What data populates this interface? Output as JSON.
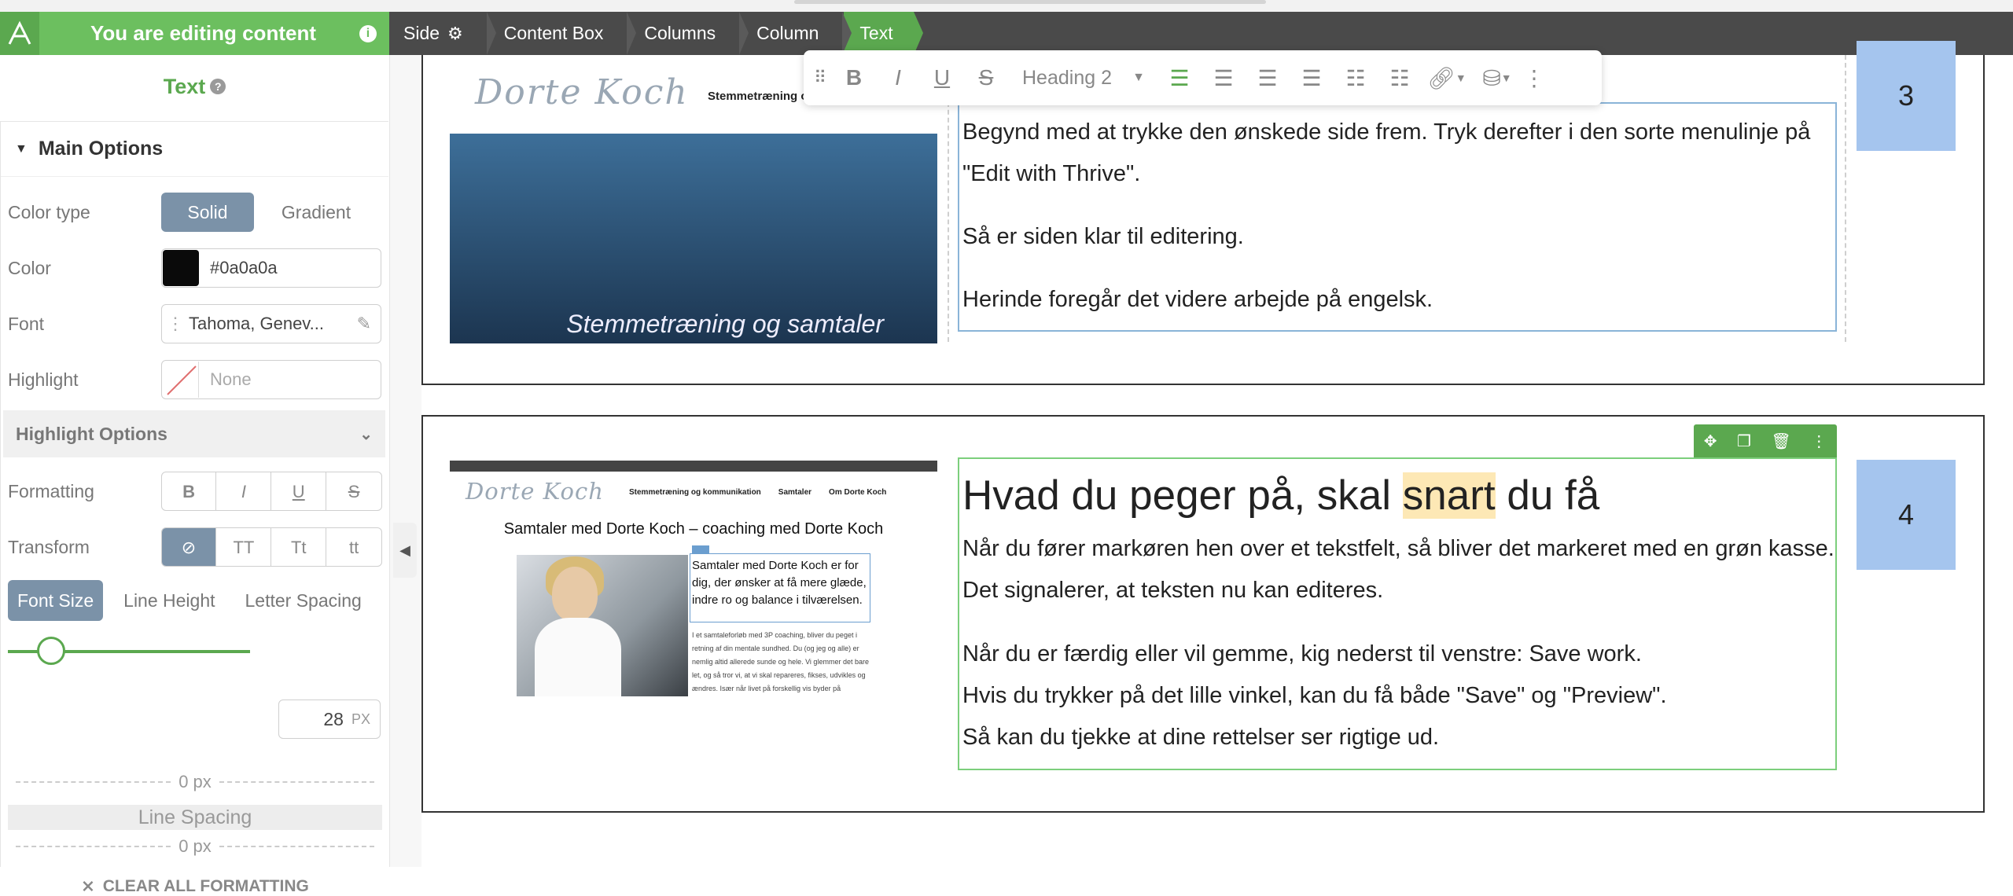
{
  "topbar": {
    "editing_label": "You are editing content",
    "crumbs": [
      "Side",
      "Content Box",
      "Columns",
      "Column",
      "Text"
    ],
    "colors": {
      "bar": "#4a4a4a",
      "green": "#6cbf5f",
      "active": "#5ba84f"
    }
  },
  "sidebar": {
    "title": "Text",
    "main_options": "Main Options",
    "color_type_label": "Color type",
    "color_type_options": [
      "Solid",
      "Gradient"
    ],
    "color_label": "Color",
    "color_value": "#0a0a0a",
    "color_display": "#0a0a0a",
    "font_label": "Font",
    "font_value": "Tahoma, Genev...",
    "highlight_label": "Highlight",
    "highlight_value": "None",
    "highlight_options": "Highlight Options",
    "formatting_label": "Formatting",
    "formatting_buttons": [
      "B",
      "I",
      "U",
      "S"
    ],
    "transform_label": "Transform",
    "transform_buttons": [
      "⊘",
      "TT",
      "Tt",
      "tt"
    ],
    "size_tabs": [
      "Font Size",
      "Line Height",
      "Letter Spacing"
    ],
    "font_size_value": "28",
    "font_size_unit": "PX",
    "font_size_fraction": 0.18,
    "spacing_top": "0 px",
    "line_spacing_label": "Line Spacing",
    "spacing_bottom": "0 px",
    "clear_label": "CLEAR ALL FORMATTING"
  },
  "toolbar": {
    "heading_select": "Heading 2"
  },
  "block1": {
    "number": "3",
    "paragraphs": [
      "Begynd med at trykke den ønskede side frem. Tryk derefter i den sorte menulinje på \"Edit with Thrive\".",
      "Så er siden klar til editering.",
      "Herinde foregår det videre arbejde på engelsk."
    ],
    "shot": {
      "logo": "Dorte Koch",
      "tagline": "Stemmetræning og",
      "caption": "Stemmetræning og samtaler"
    }
  },
  "block2": {
    "number": "4",
    "heading_before": "Hvad du peger på, skal ",
    "heading_highlight": "snart",
    "heading_after": " du få",
    "p1": "Når du fører markøren hen over et tekstfelt, så bliver det markeret med en grøn kasse. Det signalerer, at teksten nu kan editeres.",
    "p2": "Når du er færdig eller vil gemme, kig nederst til venstre: Save work.",
    "p3": "Hvis du trykker på det lille vinkel, kan du få både \"Save\" og \"Preview\".",
    "p4": "Så kan du tjekke at dine rettelser ser rigtige ud.",
    "shot": {
      "logo": "Dorte Koch",
      "nav": [
        "Stemmetræning og kommunikation",
        "Samtaler",
        "Om Dorte Koch"
      ],
      "heading": "Samtaler med Dorte Koch – coaching med Dorte Koch",
      "box_text": "Samtaler med Dorte Koch er for dig, der ønsker at få mere glæde, indre ro og balance i tilværelsen.",
      "small_text": "I et samtaleforløb med 3P coaching, bliver du peget i retning af din mentale sundhed. Du (og jeg og alle) er nemlig altid allerede sunde og hele. Vi glemmer det bare let, og så tror vi, at vi skal repareres, fikses, udvikles og ændres. Især når livet på forskellig vis byder på"
    }
  }
}
